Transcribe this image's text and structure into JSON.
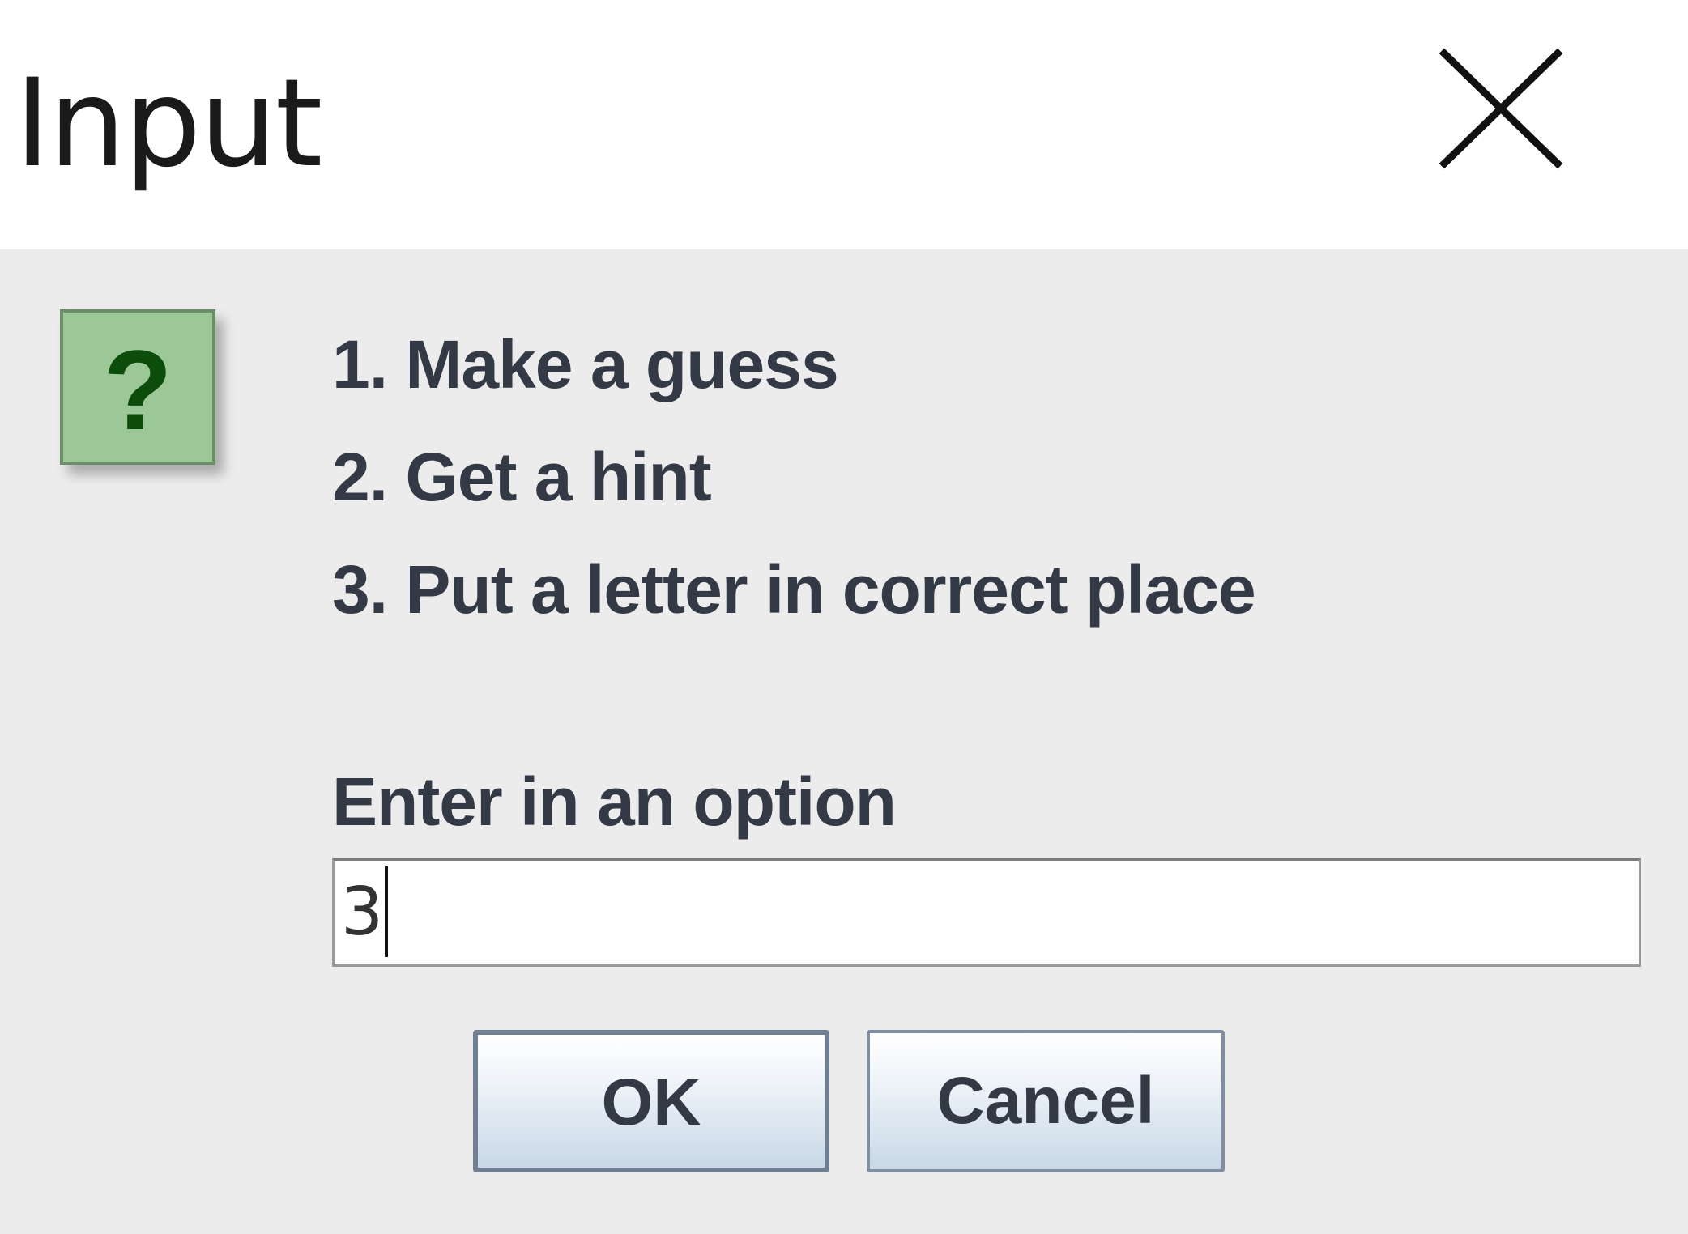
{
  "window": {
    "title": "Input",
    "close_icon": "close-icon"
  },
  "message": {
    "icon": "question-icon",
    "icon_glyph": "?",
    "lines": [
      "1. Make a guess",
      "2. Get a hint",
      "3. Put a letter in correct place"
    ],
    "prompt": "Enter in an option"
  },
  "input": {
    "value": "3"
  },
  "buttons": {
    "ok_label": "OK",
    "cancel_label": "Cancel"
  },
  "colors": {
    "titlebar": "#ffffff",
    "content_background": "#ececec",
    "icon_fill": "#9cc797",
    "icon_glyph": "#0c4d0c",
    "text": "#333a45"
  }
}
